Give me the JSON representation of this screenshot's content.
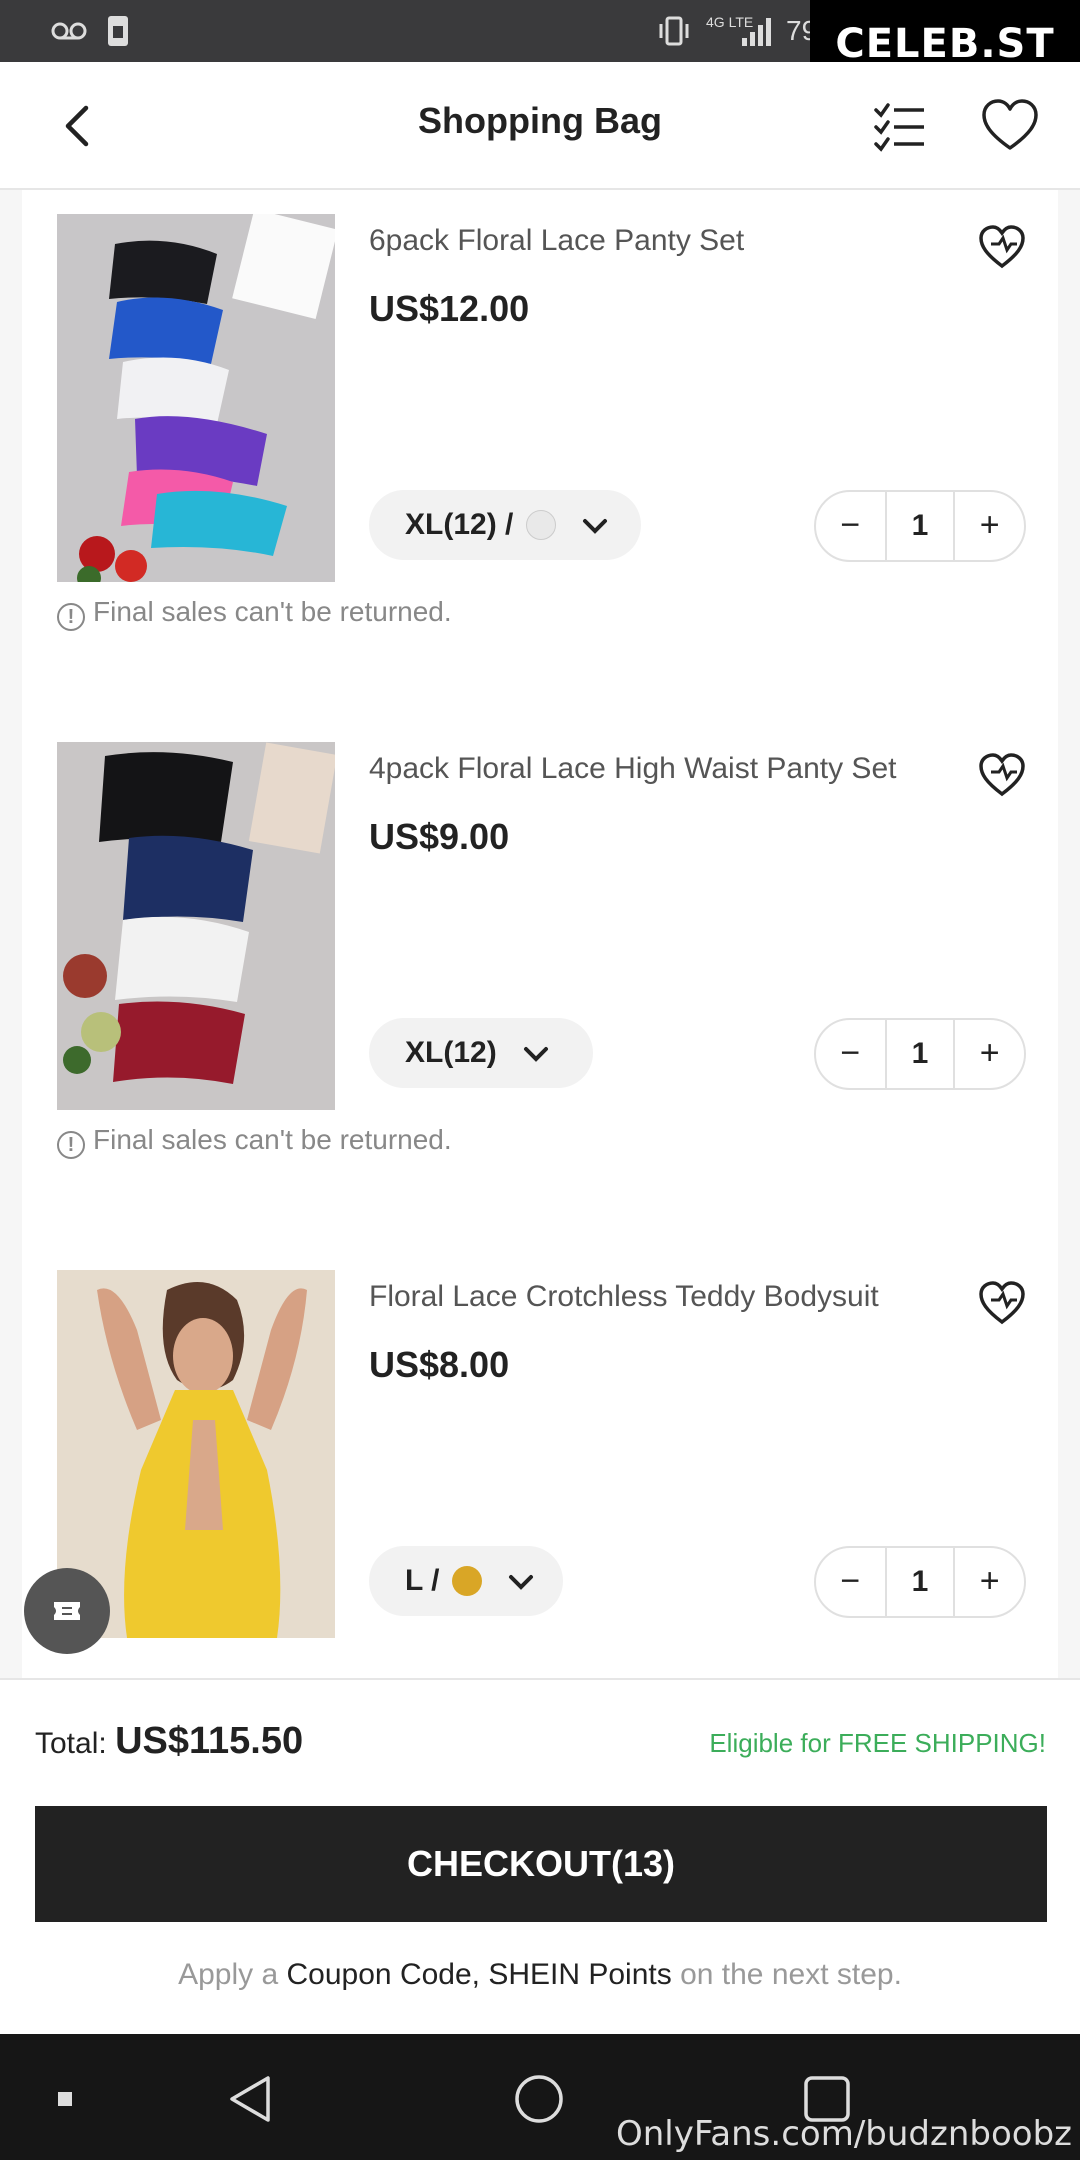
{
  "status_bar": {
    "battery": "79",
    "network": "4G LTE"
  },
  "watermark": {
    "top": "CELEB.ST",
    "bottom": "OnlyFans.com/budznboobz"
  },
  "header": {
    "title": "Shopping Bag"
  },
  "items": [
    {
      "name": "6pack Floral Lace Panty Set",
      "price": "US$12.00",
      "size": "XL(12) /",
      "swatch_color": "#e9e9e9",
      "quantity": "1",
      "note": "Final sales can't be returned."
    },
    {
      "name": "4pack Floral Lace High Waist Panty Set",
      "price": "US$9.00",
      "size": "XL(12)",
      "quantity": "1",
      "note": "Final sales can't be returned."
    },
    {
      "name": "Floral Lace Crotchless Teddy Bodysuit",
      "price": "US$8.00",
      "size": "L /",
      "swatch_color": "#d9a626",
      "quantity": "1"
    }
  ],
  "footer": {
    "total_label": "Total:",
    "total_value": "US$115.50",
    "shipping_note": "Eligible for FREE SHIPPING!",
    "checkout_label": "CHECKOUT(13)",
    "hint_prefix": "Apply a",
    "hint_links": "Coupon Code, SHEIN Points",
    "hint_suffix": "on the next step."
  },
  "colors": {
    "accent_green": "#3cad5a",
    "checkout_bg": "#222222"
  }
}
